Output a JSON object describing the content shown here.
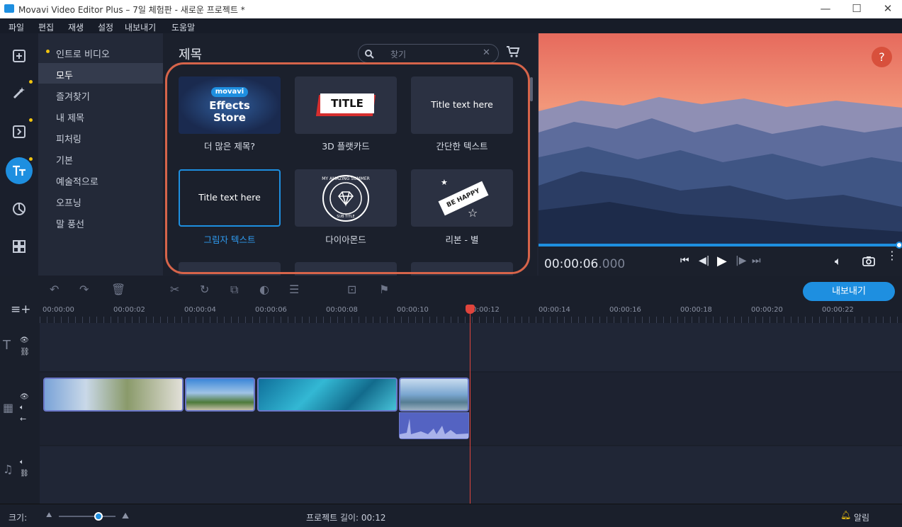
{
  "window": {
    "title": "Movavi Video Editor Plus – 7일 체험판 - 새로운 프로젝트 *",
    "minimize": "—",
    "maximize": "☐",
    "close": "✕"
  },
  "menu": [
    "파일",
    "편집",
    "재생",
    "설정",
    "내보내기",
    "도움말"
  ],
  "categories": [
    "인트로 비디오",
    "모두",
    "즐겨찾기",
    "내 제목",
    "피처링",
    "기본",
    "예술적으로",
    "오프닝",
    "말 풍선"
  ],
  "panel": {
    "title": "제목",
    "search_placeholder": "찾기"
  },
  "tiles": [
    {
      "label": "더 많은 제목?",
      "brand": "movavi",
      "line1": "Effects",
      "line2": "Store"
    },
    {
      "label": "3D 플랫카드",
      "text": "TITLE"
    },
    {
      "label": "간단한 텍스트",
      "text": "Title text here"
    },
    {
      "label": "그림자 텍스트",
      "text": "Title text here"
    },
    {
      "label": "다이아몬드",
      "top": "MY AMAZING SUMMER",
      "bottom": "SUB TITLE"
    },
    {
      "label": "리본 - 별",
      "text": "BE HAPPY"
    }
  ],
  "player": {
    "time": "00:00:06",
    "ms": ".000",
    "help": "?",
    "progress": 1.0
  },
  "export_label": "내보내기",
  "ruler": [
    "00:00:00",
    "00:00:02",
    "00:00:04",
    "00:00:06",
    "00:00:08",
    "00:00:10",
    "00:00:12",
    "00:00:14",
    "00:00:16",
    "00:00:18",
    "00:00:20",
    "00:00:22"
  ],
  "status": {
    "size_label": "크기:",
    "project_length": "프로젝트 길이:  00:12",
    "alerts": "알림"
  }
}
